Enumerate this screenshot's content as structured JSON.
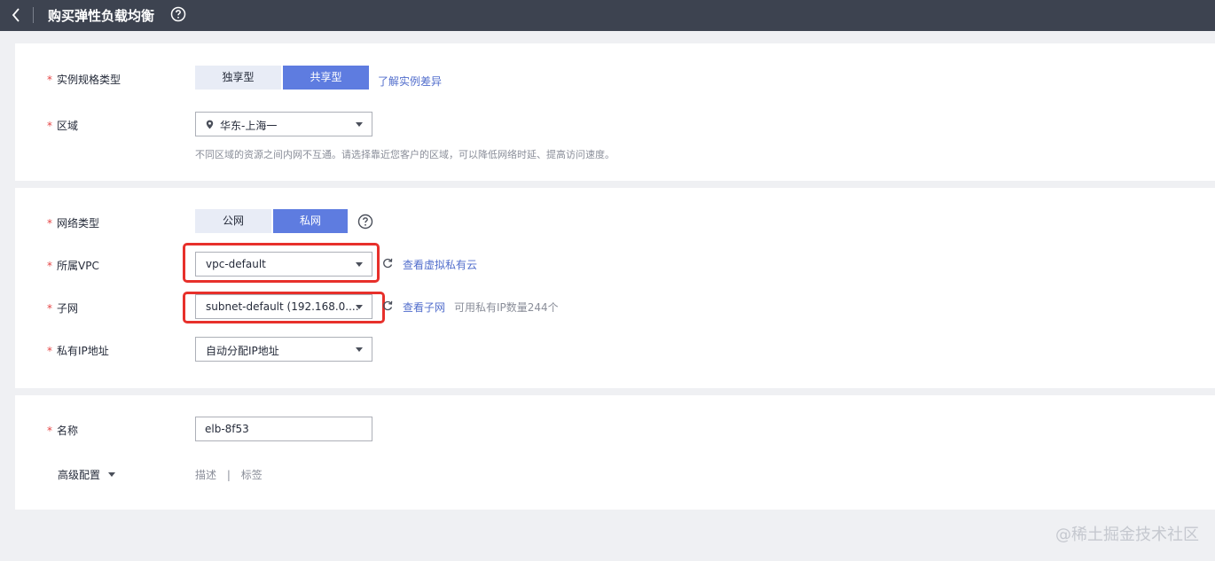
{
  "header": {
    "title": "购买弹性负载均衡"
  },
  "basic": {
    "spec_type": {
      "label": "实例规格类型",
      "options": [
        "独享型",
        "共享型"
      ],
      "selected": "共享型",
      "learn_more": "了解实例差异"
    },
    "region": {
      "label": "区域",
      "value": "华东-上海一",
      "hint": "不同区域的资源之间内网不互通。请选择靠近您客户的区域，可以降低网络时延、提高访问速度。"
    }
  },
  "network": {
    "network_type": {
      "label": "网络类型",
      "options": [
        "公网",
        "私网"
      ],
      "selected": "私网"
    },
    "vpc": {
      "label": "所属VPC",
      "value": "vpc-default",
      "link": "查看虚拟私有云"
    },
    "subnet": {
      "label": "子网",
      "value": "subnet-default (192.168.0....",
      "link": "查看子网",
      "available": "可用私有IP数量244个"
    },
    "private_ip": {
      "label": "私有IP地址",
      "value": "自动分配IP地址"
    }
  },
  "config": {
    "name": {
      "label": "名称",
      "value": "elb-8f53"
    },
    "advanced": {
      "label": "高级配置",
      "items": [
        "描述",
        "标签"
      ],
      "separator": "|"
    }
  },
  "watermark": "@稀土掘金技术社区",
  "colors": {
    "topbar": "#3d4350",
    "accent": "#5e7ce0",
    "highlight_box": "#e7302b",
    "required_star": "#e54545",
    "link": "#526ecc"
  }
}
